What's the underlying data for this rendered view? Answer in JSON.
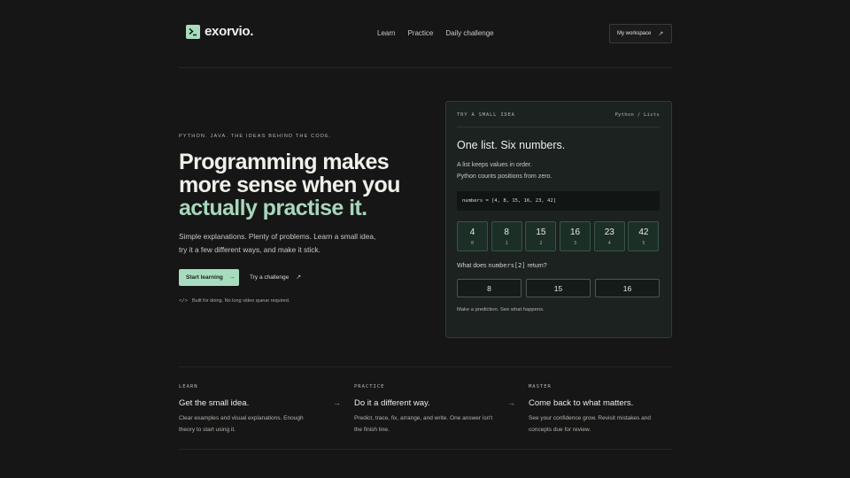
{
  "header": {
    "logo_text": "exorvio.",
    "logo_icon": "terminal-prompt-icon",
    "nav": [
      "Learn",
      "Practice",
      "Daily challenge"
    ],
    "workspace_label": "My workspace"
  },
  "hero": {
    "eyebrow": "PYTHON. JAVA. THE IDEAS BEHIND THE CODE.",
    "headline_line1": "Programming makes",
    "headline_line2": "more sense when you",
    "headline_accent": "actually practise it.",
    "desc_line1": "Simple explanations. Plenty of problems. Learn a small idea,",
    "desc_line2": "try it a few different ways, and make it stick.",
    "start_label": "Start learning",
    "challenge_label": "Try a challenge",
    "note": "Built for doing. No long video queue required."
  },
  "card": {
    "tag": "TRY A SMALL IDEA",
    "path": "Python / Lists",
    "title": "One list. Six numbers.",
    "body_line1": "A list keeps values in order.",
    "body_line2": "Python counts positions from zero.",
    "code": "numbers = [4, 8, 15, 16, 23, 42]",
    "cells": [
      {
        "value": "4",
        "index": "0"
      },
      {
        "value": "8",
        "index": "1"
      },
      {
        "value": "15",
        "index": "2"
      },
      {
        "value": "16",
        "index": "3"
      },
      {
        "value": "23",
        "index": "4"
      },
      {
        "value": "42",
        "index": "5"
      }
    ],
    "question_pre": "What does ",
    "question_code": "numbers[2]",
    "question_post": " return?",
    "options": [
      "8",
      "15",
      "16"
    ],
    "hint": "Make a prediction. See what happens."
  },
  "features": [
    {
      "label": "LEARN",
      "title": "Get the small idea.",
      "text_line1": "Clear examples and visual explanations. Enough",
      "text_line2": "theory to start using it."
    },
    {
      "label": "PRACTICE",
      "title": "Do it a different way.",
      "text_line1": "Predict, trace, fix, arrange, and write. One answer isn't",
      "text_line2": "the finish line."
    },
    {
      "label": "MASTER",
      "title": "Come back to what matters.",
      "text_line1": "See your confidence grow. Revisit mistakes and",
      "text_line2": "concepts due for review."
    }
  ],
  "colors": {
    "background": "#161616",
    "accent": "#a8dcbf",
    "accent_text": "#a8d7bb",
    "card_bg": "#1b2220"
  }
}
